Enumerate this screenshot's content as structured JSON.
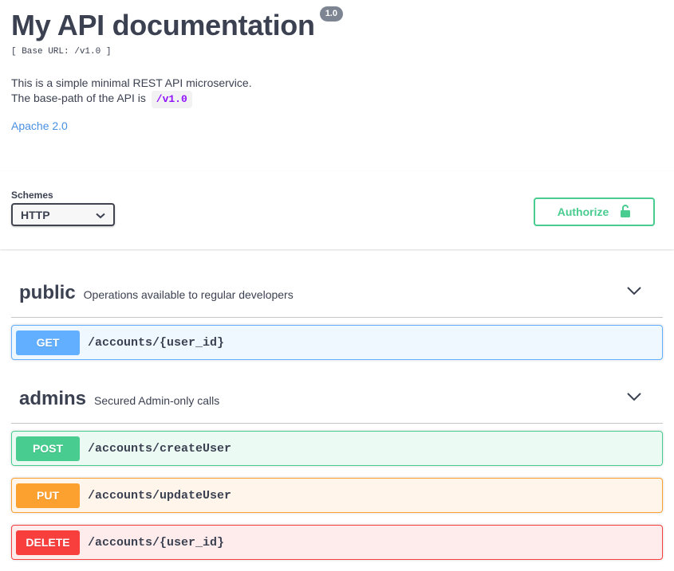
{
  "info": {
    "title": "My API documentation",
    "version": "1.0",
    "base_url": "[ Base URL: /v1.0 ]",
    "description_line1": "This is a simple minimal REST API microservice.",
    "description_line2_prefix": "The base-path of the API is",
    "description_code": "/v1.0",
    "license": "Apache 2.0"
  },
  "schemes": {
    "label": "Schemes",
    "selected": "HTTP"
  },
  "authorize": {
    "label": "Authorize",
    "icon": "unlock-icon",
    "color": "#49cc90"
  },
  "tags": [
    {
      "name": "public",
      "description": "Operations available to regular developers",
      "operations": [
        {
          "method": "GET",
          "path": "/accounts/{user_id}",
          "color": "#61affe"
        }
      ]
    },
    {
      "name": "admins",
      "description": "Secured Admin-only calls",
      "operations": [
        {
          "method": "POST",
          "path": "/accounts/createUser",
          "color": "#49cc90"
        },
        {
          "method": "PUT",
          "path": "/accounts/updateUser",
          "color": "#fca130"
        },
        {
          "method": "DELETE",
          "path": "/accounts/{user_id}",
          "color": "#f93e3e"
        }
      ]
    }
  ]
}
